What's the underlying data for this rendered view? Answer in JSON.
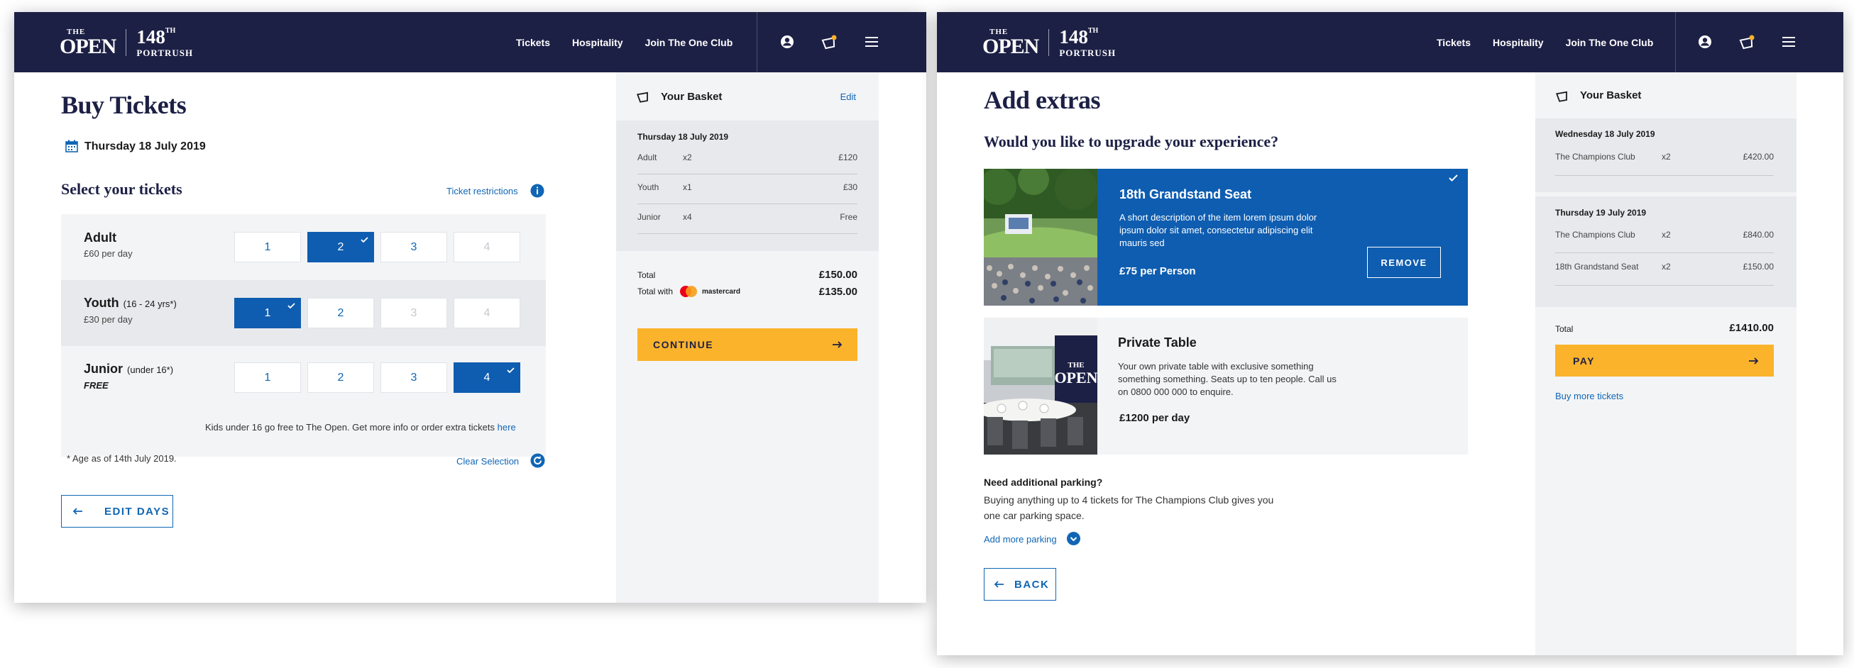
{
  "brand": {
    "the": "THE",
    "open": "OPEN",
    "edition": "148",
    "edition_suffix": "TH",
    "venue": "PORTRUSH"
  },
  "nav": {
    "links": [
      "Tickets",
      "Hospitality",
      "Join The One Club"
    ]
  },
  "screen1": {
    "title": "Buy Tickets",
    "date": "Thursday 18 July 2019",
    "select_heading": "Select your tickets",
    "restrictions_link": "Ticket restrictions",
    "rows": [
      {
        "name": "Adult",
        "age": "",
        "price": "£60 per day",
        "options": [
          "1",
          "2",
          "3",
          "4"
        ],
        "selected": "2"
      },
      {
        "name": "Youth",
        "age": "(16 - 24 yrs*)",
        "price": "£30 per day",
        "options": [
          "1",
          "2",
          "3",
          "4"
        ],
        "selected": "1"
      },
      {
        "name": "Junior",
        "age": "(under 16*)",
        "price": "FREE",
        "options": [
          "1",
          "2",
          "3",
          "4"
        ],
        "selected": "4"
      }
    ],
    "kids_note": "Kids under 16 go free to The Open.  Get more info or order extra tickets",
    "kids_link": "here",
    "age_note": "* Age as of 14th July 2019.",
    "clear": "Clear Selection",
    "edit_days": "EDIT DAYS",
    "basket": {
      "title": "Your Basket",
      "edit": "Edit",
      "day": "Thursday 18 July 2019",
      "lines": [
        {
          "label": "Adult",
          "qty": "x2",
          "price": "£120"
        },
        {
          "label": "Youth",
          "qty": "x1",
          "price": "£30"
        },
        {
          "label": "Junior",
          "qty": "x4",
          "price": "Free"
        }
      ],
      "total_label": "Total",
      "total": "£150.00",
      "total_with_label": "Total with",
      "mastercard": "mastercard",
      "total_with": "£135.00",
      "continue": "CONTINUE"
    }
  },
  "screen2": {
    "title": "Add extras",
    "question": "Would you like to upgrade your experience?",
    "extras": [
      {
        "name": "18th Grandstand Seat",
        "desc": "A short description of the item lorem ipsum dolor ipsum dolor sit amet, consectetur adipiscing elit mauris sed",
        "price": "£75 per Person",
        "action": "REMOVE"
      },
      {
        "name": "Private Table",
        "desc": "Your own private table with exclusive something something something. Seats up to ten people. Call us on 0800 000 000 to enquire.",
        "price": "£1200 per day"
      }
    ],
    "parking_heading": "Need additional parking?",
    "parking_text": "Buying anything up to 4 tickets for The Champions Club gives you one car parking space.",
    "parking_link": "Add more parking",
    "back": "BACK",
    "basket": {
      "title": "Your Basket",
      "days": [
        {
          "date": "Wednesday 18 July 2019",
          "lines": [
            {
              "label": "The Champions Club",
              "qty": "x2",
              "price": "£420.00"
            }
          ]
        },
        {
          "date": "Thursday 19 July 2019",
          "lines": [
            {
              "label": "The Champions Club",
              "qty": "x2",
              "price": "£840.00"
            },
            {
              "label": "18th Grandstand Seat",
              "qty": "x2",
              "price": "£150.00"
            }
          ]
        }
      ],
      "total_label": "Total",
      "total": "£1410.00",
      "pay": "PAY",
      "buy_more": "Buy more tickets"
    }
  },
  "colors": {
    "navy": "#1d2045",
    "blue": "#0e5db0",
    "link": "#1066b4",
    "yellow": "#fbb32c",
    "panel": "#f3f4f6"
  }
}
